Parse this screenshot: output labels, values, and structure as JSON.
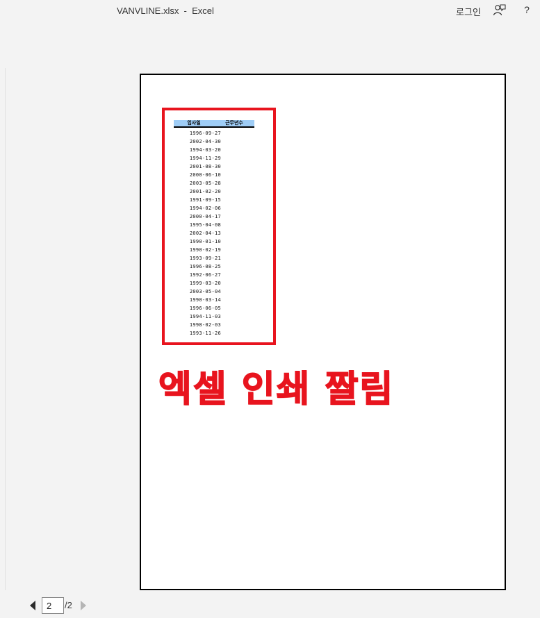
{
  "window": {
    "title": "VANVLINE.xlsx  -  Excel"
  },
  "header": {
    "signin_label": "로그인",
    "feedback_icon": "feedback-person-icon",
    "help_label": "?"
  },
  "sheet": {
    "columns": [
      "입사일",
      "근무년수"
    ],
    "header_color": "#9fcdf6",
    "dates": [
      "1996-09-27",
      "2002-04-30",
      "1994-03-20",
      "1994-11-29",
      "2001-08-30",
      "2000-06-10",
      "2003-05-28",
      "2001-02-20",
      "1991-09-15",
      "1994-02-06",
      "2000-04-17",
      "1995-04-08",
      "2002-04-13",
      "1990-01-10",
      "1990-02-19",
      "1993-09-21",
      "1996-08-25",
      "1992-06-27",
      "1999-03-20",
      "2003-05-04",
      "1990-03-14",
      "1996-06-05",
      "1994-11-03",
      "1998-02-03",
      "1993-11-26"
    ]
  },
  "annotation": {
    "caption": "엑셀 인쇄 짤림",
    "color": "#e8141e"
  },
  "pager": {
    "current_page": "2",
    "total_label": "/2"
  }
}
